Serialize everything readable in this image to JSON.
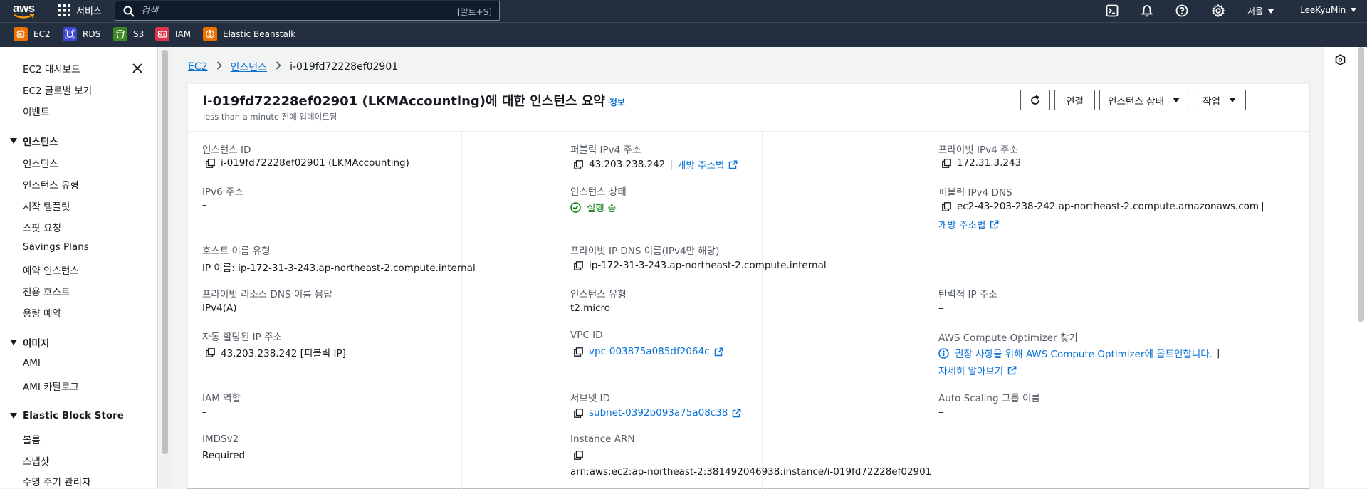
{
  "topbar": {
    "logo_text": "aws",
    "services_label": "서비스",
    "search_placeholder": "검색",
    "search_shortcut": "[알트+S]",
    "region": "서울",
    "user": "LeeKyuMin"
  },
  "favorites": [
    {
      "label": "EC2",
      "color": "#ed7100"
    },
    {
      "label": "RDS",
      "color": "#3b48cc"
    },
    {
      "label": "S3",
      "color": "#3f8624"
    },
    {
      "label": "IAM",
      "color": "#dd344c"
    },
    {
      "label": "Elastic Beanstalk",
      "color": "#ed7100"
    }
  ],
  "sidebar": {
    "top_items": [
      "EC2 대시보드",
      "EC2 글로벌 보기",
      "이벤트"
    ],
    "sections": [
      {
        "title": "인스턴스",
        "items": [
          "인스턴스",
          "인스턴스 유형",
          "시작 템플릿",
          "스팟 요청",
          "Savings Plans",
          "예약 인스턴스",
          "전용 호스트",
          "용량 예약"
        ]
      },
      {
        "title": "이미지",
        "items": [
          "AMI",
          "AMI 카탈로그"
        ]
      },
      {
        "title": "Elastic Block Store",
        "items": [
          "볼륨",
          "스냅샷",
          "수명 주기 관리자"
        ]
      }
    ]
  },
  "breadcrumb": [
    "EC2",
    "인스턴스",
    "i-019fd72228ef02901"
  ],
  "summary": {
    "title": "i-019fd72228ef02901 (LKMAccounting)에 대한 인스턴스 요약",
    "info_link": "정보",
    "updated": "less than a minute 전에 업데이트됨",
    "buttons": {
      "refresh": "refresh",
      "connect": "연결",
      "state": "인스턴스 상태",
      "actions": "작업"
    }
  },
  "fields": {
    "instance_id": {
      "label": "인스턴스 ID",
      "value": "i-019fd72228ef02901 (LKMAccounting)"
    },
    "public_ipv4": {
      "label": "퍼블릭 IPv4 주소",
      "value": "43.203.238.242",
      "sep": "|",
      "link": "개방 주소법"
    },
    "private_ipv4": {
      "label": "프라이빗 IPv4 주소",
      "value": "172.31.3.243"
    },
    "ipv6": {
      "label": "IPv6 주소",
      "value": "–"
    },
    "instance_state": {
      "label": "인스턴스 상태",
      "value": "실행 중"
    },
    "public_dns": {
      "label": "퍼블릭 IPv4 DNS",
      "value": "ec2-43-203-238-242.ap-northeast-2.compute.amazonaws.com",
      "sep": "|",
      "link": "개방 주소법"
    },
    "hostname_type": {
      "label": "호스트 이름 유형",
      "value": "IP 이름: ip-172-31-3-243.ap-northeast-2.compute.internal"
    },
    "private_dns": {
      "label": "프라이빗 IP DNS 이름(IPv4만 해당)",
      "value": "ip-172-31-3-243.ap-northeast-2.compute.internal"
    },
    "private_resource_dns": {
      "label": "프라이빗 리소스 DNS 이름 응답",
      "value": "IPv4(A)"
    },
    "instance_type": {
      "label": "인스턴스 유형",
      "value": "t2.micro"
    },
    "elastic_ip": {
      "label": "탄력적 IP 주소",
      "value": "–"
    },
    "auto_ip": {
      "label": "자동 할당된 IP 주소",
      "value": "43.203.238.242 [퍼블릭 IP]"
    },
    "vpc_id": {
      "label": "VPC ID",
      "value": "vpc-003875a085df2064c"
    },
    "compute_optimizer": {
      "label": "AWS Compute Optimizer 찾기",
      "value": "권장 사항을 위해 AWS Compute Optimizer에 옵트인합니다.",
      "sep": "|",
      "link": "자세히 알아보기"
    },
    "iam_role": {
      "label": "IAM 역할",
      "value": "–"
    },
    "subnet_id": {
      "label": "서브넷 ID",
      "value": "subnet-0392b093a75a08c38"
    },
    "asg_name": {
      "label": "Auto Scaling 그룹 이름",
      "value": "–"
    },
    "imdsv2": {
      "label": "IMDSv2",
      "value": "Required"
    },
    "instance_arn": {
      "label": "Instance ARN",
      "value": "arn:aws:ec2:ap-northeast-2:381492046938:instance/i-019fd72228ef02901"
    }
  }
}
